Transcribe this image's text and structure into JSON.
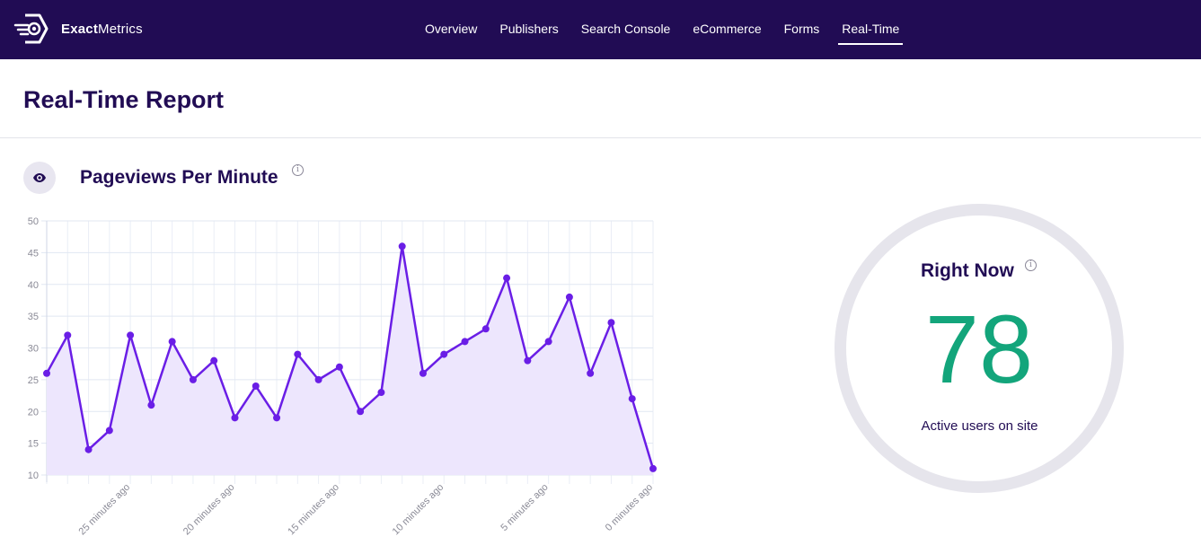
{
  "app": {
    "brand_bold": "Exact",
    "brand_light": "Metrics"
  },
  "nav": {
    "items": [
      {
        "label": "Overview",
        "active": false
      },
      {
        "label": "Publishers",
        "active": false
      },
      {
        "label": "Search Console",
        "active": false
      },
      {
        "label": "eCommerce",
        "active": false
      },
      {
        "label": "Forms",
        "active": false
      },
      {
        "label": "Real-Time",
        "active": true
      }
    ]
  },
  "page": {
    "title": "Real-Time Report"
  },
  "pageviews": {
    "title": "Pageviews Per Minute",
    "icon": "eye-icon",
    "info_icon": "info-icon"
  },
  "right_now": {
    "title": "Right Now",
    "value": "78",
    "label": "Active users on site",
    "value_color": "#13a57b"
  },
  "colors": {
    "nav_bg": "#210c54",
    "line": "#6a1ee6",
    "fill": "#ede6fd",
    "title": "#210c54"
  },
  "chart_data": {
    "type": "area",
    "title": "Pageviews Per Minute",
    "xlabel": "",
    "ylabel": "",
    "ylim": [
      10,
      50
    ],
    "yticks": [
      10,
      15,
      20,
      25,
      30,
      35,
      40,
      45,
      50
    ],
    "x_count": 30,
    "x_tick_labels": [
      {
        "index": 4,
        "label": "25 minutes ago"
      },
      {
        "index": 9,
        "label": "20 minutes ago"
      },
      {
        "index": 14,
        "label": "15 minutes ago"
      },
      {
        "index": 19,
        "label": "10 minutes ago"
      },
      {
        "index": 24,
        "label": "5 minutes ago"
      },
      {
        "index": 29,
        "label": "0 minutes ago"
      }
    ],
    "grid": true,
    "legend": "none",
    "series": [
      {
        "name": "Pageviews",
        "values": [
          26,
          32,
          14,
          17,
          32,
          21,
          31,
          25,
          28,
          19,
          24,
          19,
          29,
          25,
          27,
          20,
          23,
          46,
          26,
          29,
          31,
          33,
          41,
          28,
          31,
          38,
          26,
          34,
          22,
          11
        ]
      }
    ]
  }
}
